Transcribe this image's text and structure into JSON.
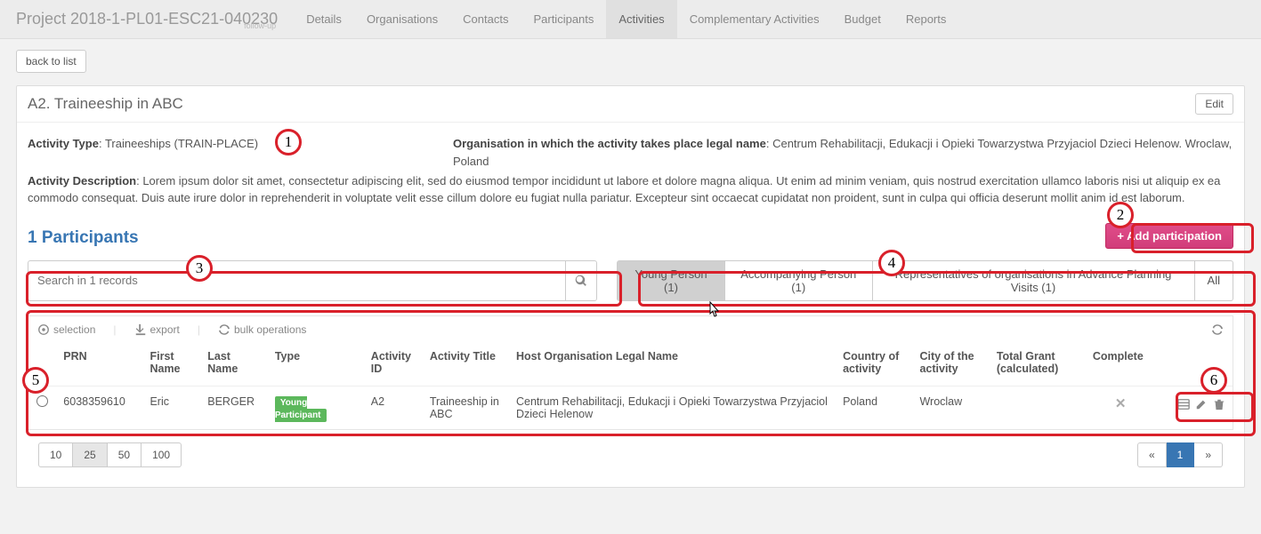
{
  "header": {
    "project_title": "Project 2018-1-PL01-ESC21-040230",
    "subtitle": "follow-up",
    "tabs": [
      "Details",
      "Organisations",
      "Contacts",
      "Participants",
      "Activities",
      "Complementary Activities",
      "Budget",
      "Reports"
    ],
    "active_tab": "Activities"
  },
  "back_button": "back to list",
  "activity": {
    "title": "A2. Traineeship in ABC",
    "edit_label": "Edit",
    "type_label": "Activity Type",
    "type_value": "Traineeships (TRAIN-PLACE)",
    "org_label": "Organisation in which the activity takes place legal name",
    "org_value": "Centrum Rehabilitacji, Edukacji i Opieki Towarzystwa Przyjaciol Dzieci Helenow. Wroclaw, Poland",
    "desc_label": "Activity Description",
    "desc_value": "Lorem ipsum dolor sit amet, consectetur adipiscing elit, sed do eiusmod tempor incididunt ut labore et dolore magna aliqua. Ut enim ad minim veniam, quis nostrud exercitation ullamco laboris nisi ut aliquip ex ea commodo consequat. Duis aute irure dolor in reprehenderit in voluptate velit esse cillum dolore eu fugiat nulla pariatur. Excepteur sint occaecat cupidatat non proident, sunt in culpa qui officia deserunt mollit anim id est laborum."
  },
  "participants_section": {
    "title": "1 Participants",
    "add_button": "+ Add participation",
    "search_placeholder": "Search in 1 records",
    "filters": [
      "Young Person (1)",
      "Accompanying Person (1)",
      "Representatives of organisations in Advance Planning Visits (1)",
      "All"
    ],
    "active_filter": "Young Person (1)"
  },
  "toolbar": {
    "selection": "selection",
    "export": "export",
    "bulk": "bulk operations"
  },
  "table": {
    "columns": [
      "",
      "PRN",
      "First Name",
      "Last Name",
      "Type",
      "Activity ID",
      "Activity Title",
      "Host Organisation Legal Name",
      "Country of activity",
      "City of the activity",
      "Total Grant (calculated)",
      "Complete",
      ""
    ],
    "rows": [
      {
        "prn": "6038359610",
        "first_name": "Eric",
        "last_name": "BERGER",
        "type_badge": "Young Participant",
        "activity_id": "A2",
        "activity_title": "Traineeship in ABC",
        "host_org": "Centrum Rehabilitacji, Edukacji i Opieki Towarzystwa Przyjaciol Dzieci Helenow",
        "country": "Poland",
        "city": "Wroclaw",
        "total_grant": "",
        "complete": "✕"
      }
    ]
  },
  "pager": {
    "sizes": [
      "10",
      "25",
      "50",
      "100"
    ],
    "active_size": "25",
    "prev": "«",
    "page": "1",
    "next": "»"
  },
  "callouts": [
    "1",
    "2",
    "3",
    "4",
    "5",
    "6"
  ]
}
